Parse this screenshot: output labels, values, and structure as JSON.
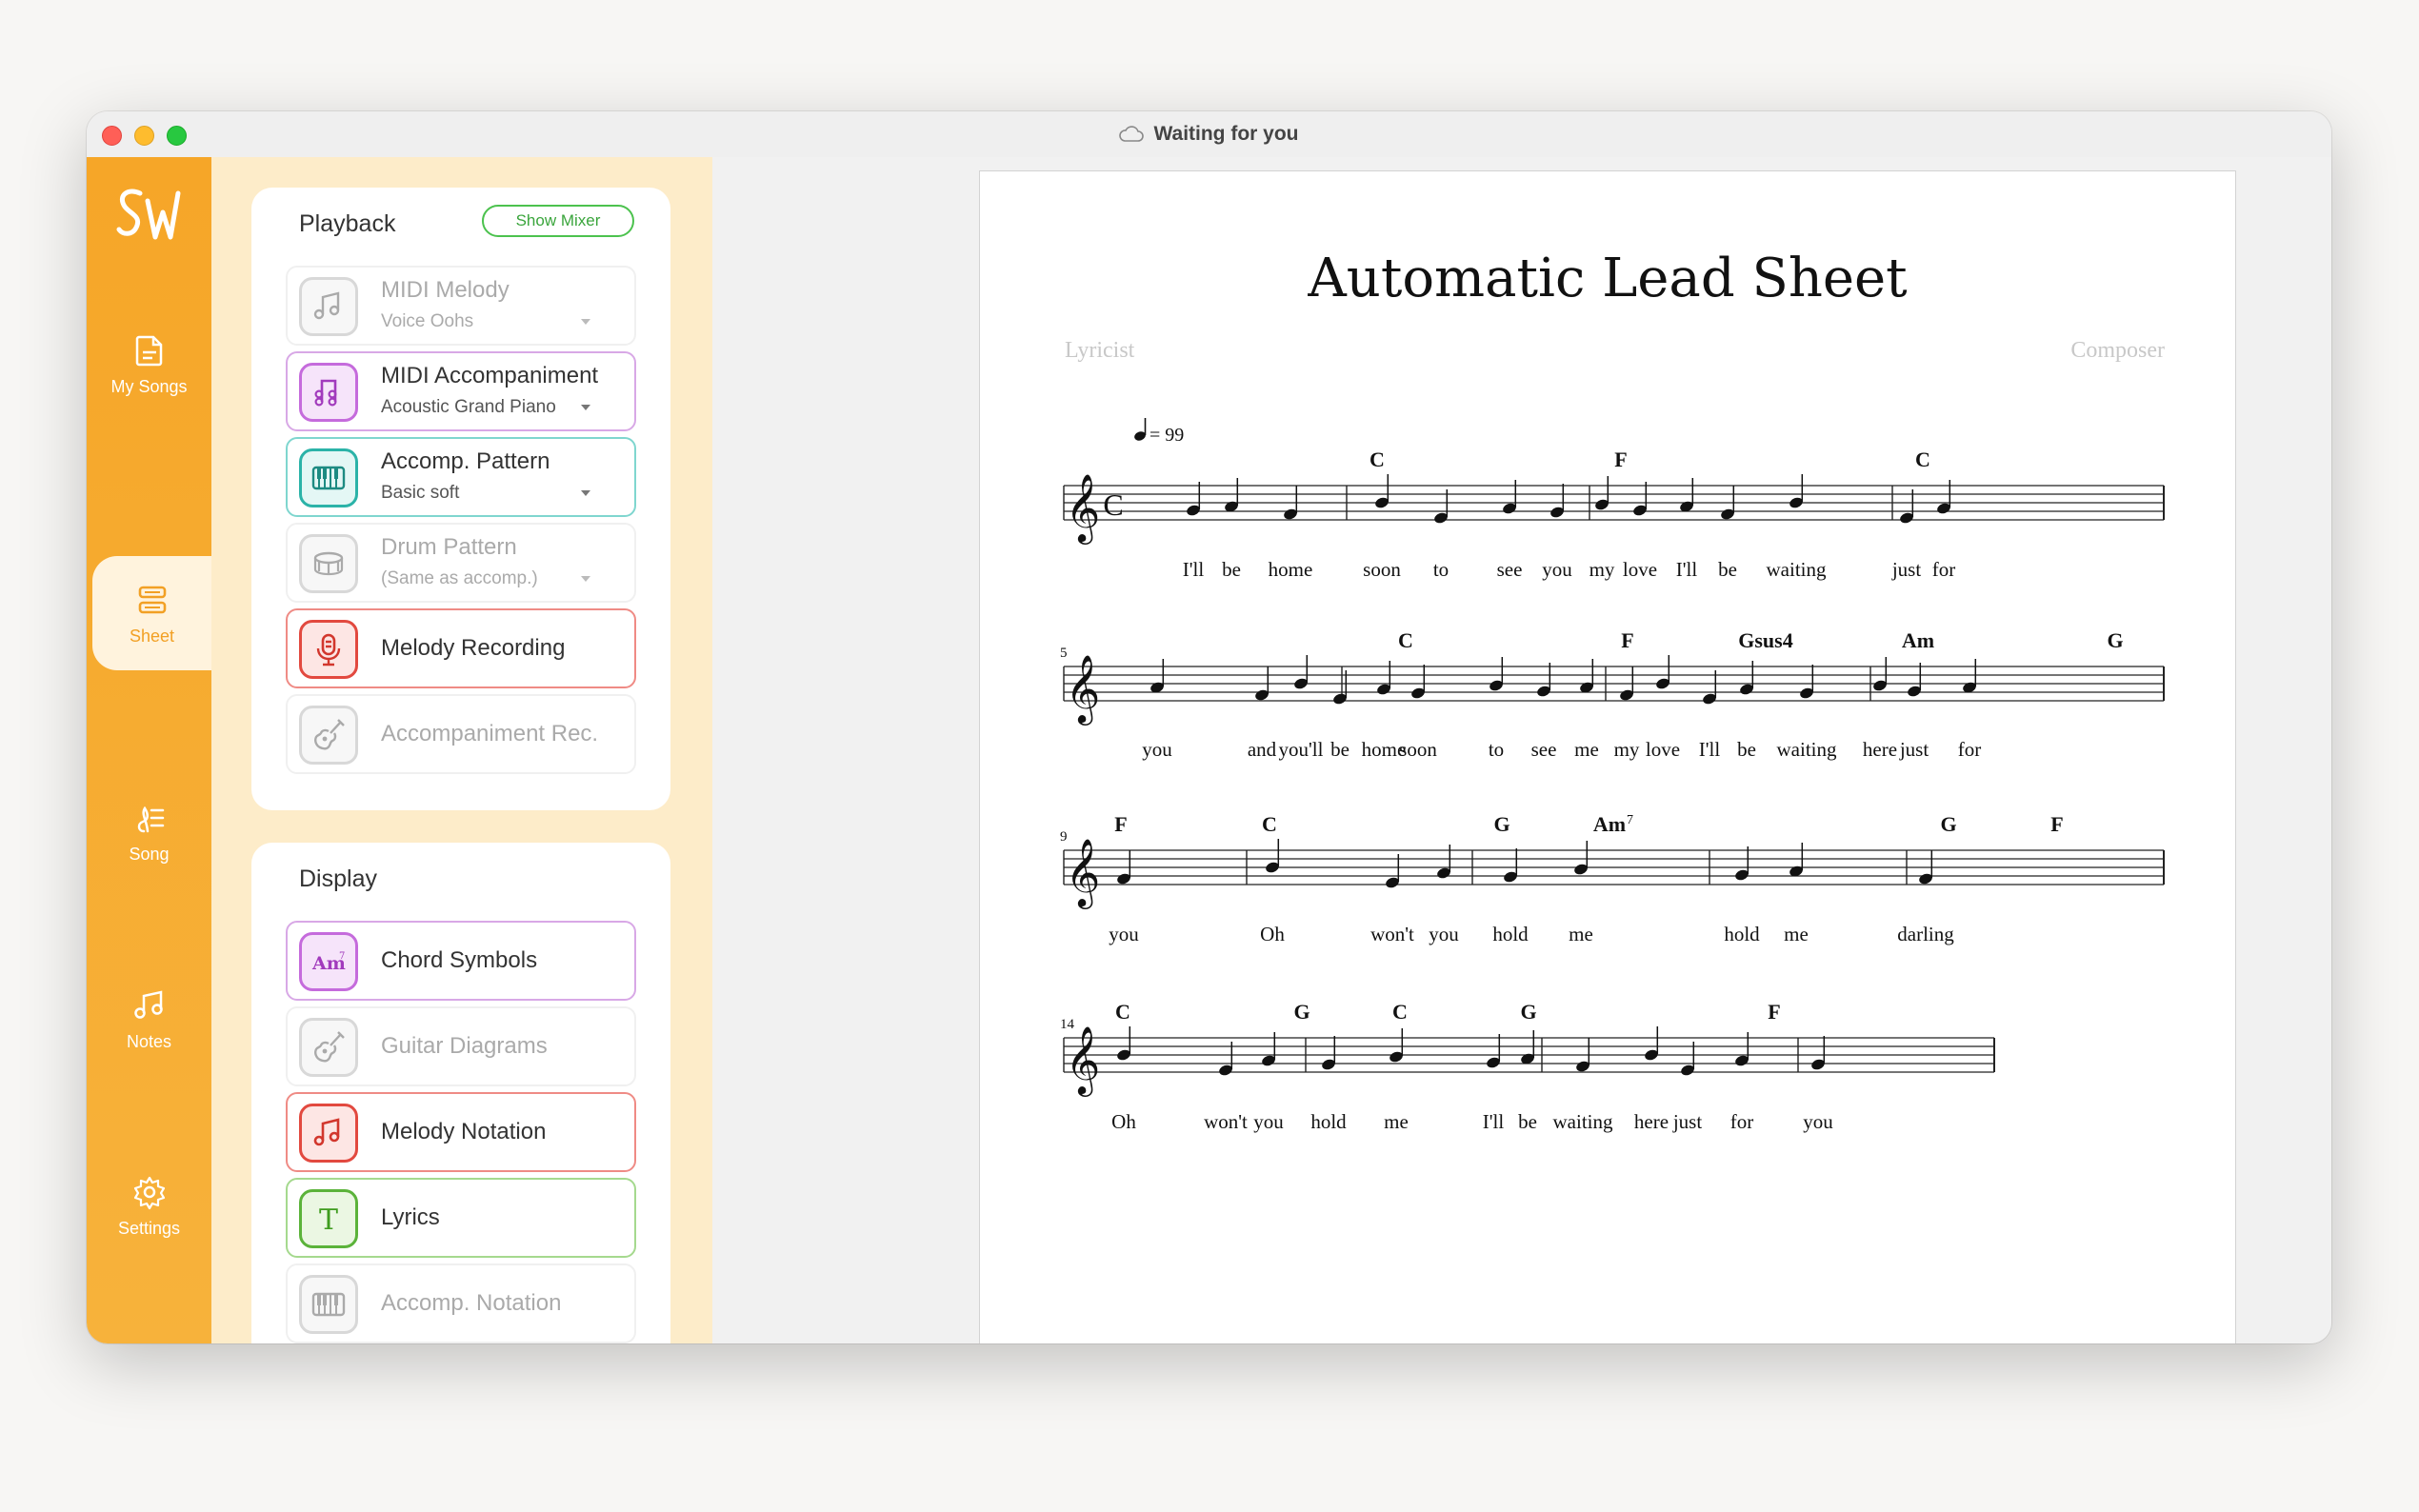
{
  "window": {
    "title": "Waiting for you"
  },
  "nav": [
    {
      "label": "My Songs",
      "icon": "document-icon"
    },
    {
      "label": "Sheet",
      "icon": "sheet-icon",
      "active": true
    },
    {
      "label": "Song",
      "icon": "song-icon"
    },
    {
      "label": "Notes",
      "icon": "music-note-icon"
    },
    {
      "label": "Settings",
      "icon": "gear-icon"
    }
  ],
  "playback": {
    "title": "Playback",
    "show_mixer": "Show Mixer",
    "items": [
      {
        "label": "MIDI Melody",
        "sub": "Voice Oohs",
        "enabled": false
      },
      {
        "label": "MIDI Accompaniment",
        "sub": "Acoustic Grand Piano",
        "enabled": true,
        "color": "#c56bdc"
      },
      {
        "label": "Accomp. Pattern",
        "sub": "Basic soft",
        "enabled": true,
        "color": "#2bb3a8"
      },
      {
        "label": "Drum Pattern",
        "sub": "(Same as accomp.)",
        "enabled": false
      },
      {
        "label": "Melody Recording",
        "enabled": true,
        "color": "#e2493f"
      },
      {
        "label": "Accompaniment Rec.",
        "enabled": false
      }
    ]
  },
  "display": {
    "title": "Display",
    "items": [
      {
        "label": "Chord Symbols",
        "enabled": true,
        "color": "#c56bdc",
        "icon_text": "Am7"
      },
      {
        "label": "Guitar Diagrams",
        "enabled": false
      },
      {
        "label": "Melody Notation",
        "enabled": true,
        "color": "#e2493f"
      },
      {
        "label": "Lyrics",
        "enabled": true,
        "color": "#5bb33a",
        "icon_text": "T"
      },
      {
        "label": "Accomp. Notation",
        "enabled": false
      }
    ]
  },
  "sheet": {
    "title": "Automatic Lead Sheet",
    "lyricist": "Lyricist",
    "composer": "Composer",
    "tempo": "= 99",
    "time_signature": "C",
    "systems": [
      {
        "measure_number": "",
        "chords": [
          "C",
          "F",
          "C"
        ],
        "lyrics": [
          "I'll",
          "be",
          "home",
          "soon",
          "to",
          "see",
          "you",
          "my",
          "love",
          "I'll",
          "be",
          "waiting",
          "just",
          "for"
        ]
      },
      {
        "measure_number": "5",
        "chords": [
          "C",
          "F",
          "Gsus4",
          "Am",
          "G"
        ],
        "lyrics": [
          "you",
          "and",
          "you'll",
          "be",
          "home",
          "soon",
          "to",
          "see",
          "me",
          "my",
          "love",
          "I'll",
          "be",
          "waiting",
          "here",
          "just",
          "for"
        ]
      },
      {
        "measure_number": "9",
        "chords": [
          "F",
          "C",
          "G",
          "Am7",
          "G",
          "F"
        ],
        "lyrics": [
          "you",
          "Oh",
          "won't",
          "you",
          "hold",
          "me",
          "hold",
          "me",
          "darling"
        ]
      },
      {
        "measure_number": "14",
        "chords": [
          "C",
          "G",
          "C",
          "G",
          "F"
        ],
        "lyrics": [
          "Oh",
          "won't",
          "you",
          "hold",
          "me",
          "I'll",
          "be",
          "waiting",
          "here",
          "just",
          "for",
          "you"
        ]
      }
    ]
  }
}
